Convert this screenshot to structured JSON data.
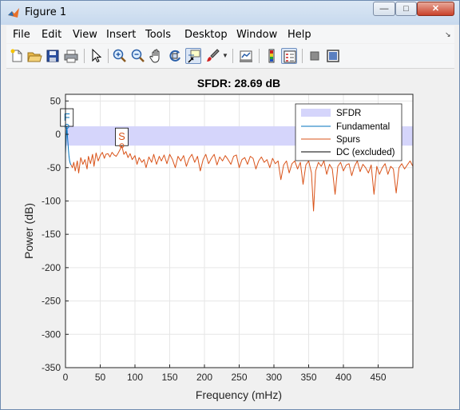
{
  "window": {
    "title": "Figure 1"
  },
  "menubar": [
    "File",
    "Edit",
    "View",
    "Insert",
    "Tools",
    "Desktop",
    "Window",
    "Help"
  ],
  "toolbar": [
    {
      "name": "new-figure-icon"
    },
    {
      "name": "open-file-icon"
    },
    {
      "name": "save-icon"
    },
    {
      "name": "print-icon"
    },
    {
      "name": "pointer-icon"
    },
    {
      "name": "zoom-in-icon"
    },
    {
      "name": "zoom-out-icon"
    },
    {
      "name": "pan-icon"
    },
    {
      "name": "rotate-3d-icon"
    },
    {
      "name": "data-cursor-icon"
    },
    {
      "name": "brush-icon"
    },
    {
      "name": "link-plot-icon"
    },
    {
      "name": "insert-colorbar-icon"
    },
    {
      "name": "insert-legend-icon"
    },
    {
      "name": "hide-plot-tools-icon"
    },
    {
      "name": "show-plot-tools-icon"
    }
  ],
  "chart_data": {
    "type": "line",
    "title": "SFDR:  28.69 dB",
    "xlabel": "Frequency (mHz)",
    "ylabel": "Power (dB)",
    "xlim": [
      0,
      500
    ],
    "ylim": [
      -350,
      60
    ],
    "xticks": [
      0,
      50,
      100,
      150,
      200,
      250,
      300,
      350,
      400,
      450
    ],
    "yticks": [
      50,
      0,
      -50,
      -100,
      -150,
      -200,
      -250,
      -300,
      -350
    ],
    "grid": true,
    "legend_position": "top-right",
    "legend": [
      "SFDR",
      "Fundamental",
      "Spurs",
      "DC (excluded)"
    ],
    "sfdr_band": {
      "y_top": 12,
      "y_bottom": -17,
      "value_db": 28.69
    },
    "markers": [
      {
        "label": "F",
        "x": 2,
        "y": 12
      },
      {
        "label": "S",
        "x": 81,
        "y": -17
      }
    ],
    "series": [
      {
        "name": "Fundamental",
        "color": "#0072bd",
        "x": [
          0,
          1,
          2,
          3,
          4,
          5,
          6,
          7,
          8
        ],
        "y": [
          -30,
          -5,
          12,
          -5,
          -20,
          -32,
          -40,
          -44,
          -46
        ]
      },
      {
        "name": "Spurs",
        "color": "#d95319",
        "x": [
          8,
          10,
          12,
          14,
          17,
          19,
          22,
          25,
          28,
          31,
          33,
          36,
          39,
          41,
          44,
          47,
          50,
          53,
          56,
          58,
          61,
          64,
          67,
          70,
          73,
          76,
          79,
          81,
          84,
          87,
          90,
          93,
          96,
          100,
          103,
          106,
          110,
          113,
          116,
          120,
          124,
          127,
          131,
          135,
          138,
          142,
          146,
          150,
          154,
          158,
          162,
          166,
          170,
          174,
          178,
          182,
          186,
          190,
          194,
          198,
          202,
          206,
          210,
          214,
          218,
          222,
          226,
          230,
          234,
          238,
          242,
          246,
          250,
          254,
          258,
          262,
          266,
          270,
          274,
          278,
          282,
          286,
          290,
          294,
          298,
          302,
          306,
          310,
          314,
          318,
          322,
          326,
          330,
          334,
          338,
          342,
          346,
          350,
          354,
          357,
          360,
          364,
          368,
          372,
          376,
          380,
          384,
          388,
          392,
          396,
          400,
          404,
          408,
          412,
          416,
          420,
          424,
          428,
          432,
          436,
          440,
          444,
          448,
          452,
          456,
          460,
          464,
          468,
          472,
          476,
          480,
          484,
          488,
          492,
          496,
          500
        ],
        "y": [
          -46,
          -50,
          -42,
          -55,
          -40,
          -58,
          -35,
          -45,
          -38,
          -52,
          -33,
          -44,
          -30,
          -48,
          -28,
          -40,
          -32,
          -27,
          -36,
          -30,
          -29,
          -34,
          -27,
          -31,
          -33,
          -28,
          -22,
          -17,
          -30,
          -26,
          -35,
          -29,
          -38,
          -32,
          -45,
          -35,
          -42,
          -38,
          -50,
          -34,
          -42,
          -30,
          -45,
          -33,
          -40,
          -31,
          -44,
          -30,
          -38,
          -50,
          -33,
          -40,
          -32,
          -48,
          -36,
          -30,
          -42,
          -33,
          -55,
          -38,
          -30,
          -44,
          -36,
          -30,
          -46,
          -34,
          -40,
          -32,
          -38,
          -45,
          -33,
          -31,
          -50,
          -38,
          -35,
          -45,
          -33,
          -36,
          -52,
          -40,
          -34,
          -42,
          -38,
          -50,
          -36,
          -44,
          -40,
          -68,
          -46,
          -40,
          -58,
          -44,
          -40,
          -52,
          -42,
          -75,
          -46,
          -40,
          -58,
          -115,
          -55,
          -42,
          -48,
          -40,
          -60,
          -45,
          -52,
          -90,
          -48,
          -42,
          -55,
          -46,
          -44,
          -62,
          -48,
          -40,
          -56,
          -45,
          -50,
          -58,
          -46,
          -90,
          -48,
          -60,
          -50,
          -44,
          -60,
          -48,
          -52,
          -88,
          -50,
          -44,
          -52,
          -46,
          -40,
          -48
        ]
      },
      {
        "name": "DC (excluded)",
        "color": "#000000",
        "x": [],
        "y": []
      }
    ]
  }
}
